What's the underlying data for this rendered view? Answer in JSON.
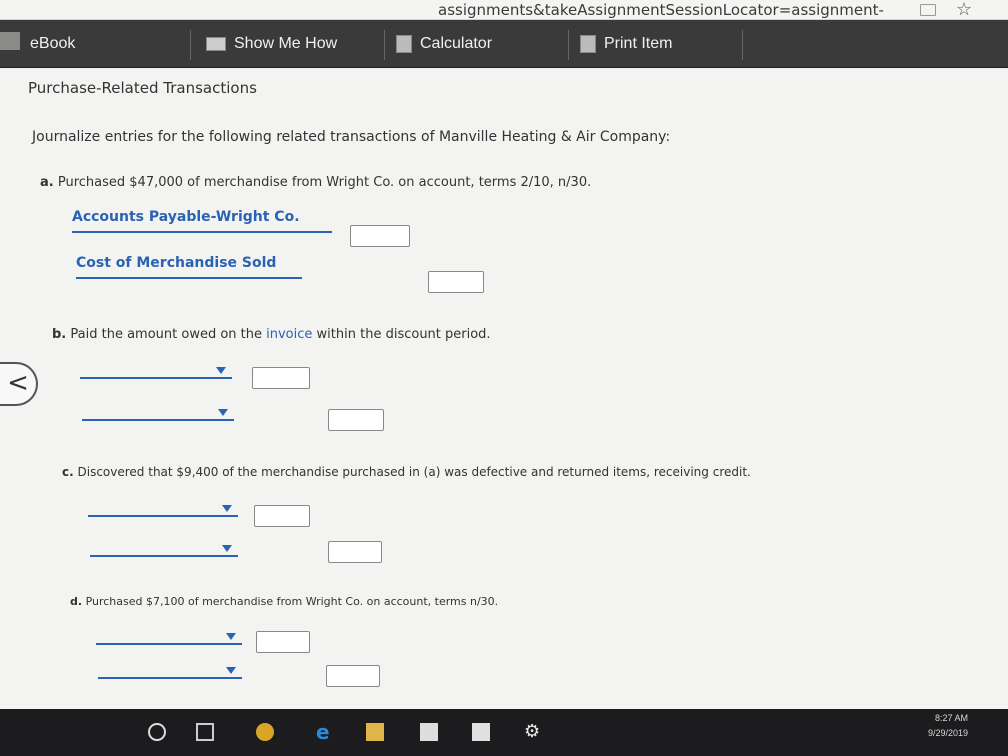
{
  "browser": {
    "url_fragment": "assignments&takeAssignmentSessionLocator=assignment-"
  },
  "toolbar": {
    "ebook": "eBook",
    "show_me_how": "Show Me How",
    "calculator": "Calculator",
    "print_item": "Print Item"
  },
  "page": {
    "title": "Purchase-Related Transactions",
    "instruction": "Journalize entries for the following related transactions of Manville Heating & Air Company:"
  },
  "transactions": [
    {
      "letter": "a.",
      "text": "Purchased $47,000 of merchandise from Wright Co. on account, terms 2/10, n/30.",
      "rows": [
        {
          "account": "Accounts Payable-Wright Co.",
          "amount": ""
        },
        {
          "account": "Cost of Merchandise Sold",
          "amount": ""
        }
      ]
    },
    {
      "letter": "b.",
      "text_before": "Paid the amount owed on the",
      "link": "invoice",
      "text_after": "within the discount period.",
      "rows": [
        {
          "account": "",
          "amount": ""
        },
        {
          "account": "",
          "amount": ""
        }
      ]
    },
    {
      "letter": "c.",
      "text": "Discovered that $9,400 of the merchandise purchased in (a) was defective and returned items, receiving credit.",
      "rows": [
        {
          "account": "",
          "amount": ""
        },
        {
          "account": "",
          "amount": ""
        }
      ]
    },
    {
      "letter": "d.",
      "text": "Purchased $7,100 of merchandise from Wright Co. on account, terms n/30.",
      "rows": [
        {
          "account": "",
          "amount": ""
        },
        {
          "account": "",
          "amount": ""
        }
      ]
    }
  ],
  "nav": {
    "back_glyph": "<"
  },
  "taskbar": {
    "time": "8:27 AM",
    "date": "9/29/2019"
  },
  "colors": {
    "link": "#2a63b3",
    "toolbar": "#3a3a3a",
    "taskbar": "#1c1c1e"
  }
}
